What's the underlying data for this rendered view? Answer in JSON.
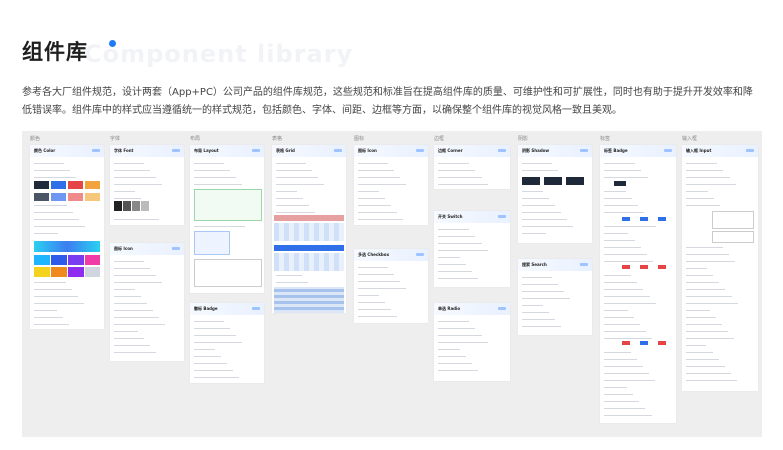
{
  "page": {
    "title": "组件库",
    "title_watermark": "Component library",
    "description": "参考各大厂组件规范，设计两套（App+PC）公司产品的组件库规范，这些规范和标准旨在提高组件库的质量、可维护性和可扩展性，同时也有助于提升开发效率和降低错误率。组件库中的样式应当遵循统一的样式规范，包括颜色、字体、间距、边框等方面，以确保整个组件库的视觉风格一致且美观。",
    "accent_color": "#1e7bf5"
  },
  "board": {
    "columns": [
      {
        "label": "颜色"
      },
      {
        "label": "字体"
      },
      {
        "label": "布局"
      },
      {
        "label": "表格"
      },
      {
        "label": "图标"
      },
      {
        "label": "边框"
      },
      {
        "label": "阴影"
      },
      {
        "label": "标签"
      },
      {
        "label": "输入框"
      }
    ],
    "cards": [
      {
        "title": "颜色 Color"
      },
      {
        "title": "字体 Font"
      },
      {
        "title": "图标 Icon"
      },
      {
        "title": "布局 Layout"
      },
      {
        "title": "徽标 Badge"
      },
      {
        "title": "表格 Grid"
      },
      {
        "title": "图标 Icon"
      },
      {
        "title": "多选 Checkbox"
      },
      {
        "title": "边框 Corner"
      },
      {
        "title": "开关 Switch"
      },
      {
        "title": "单选 Radio"
      },
      {
        "title": "阴影 Shadow"
      },
      {
        "title": "搜索 Search"
      },
      {
        "title": "标签 Badge"
      },
      {
        "title": "输入框 Input"
      }
    ]
  }
}
